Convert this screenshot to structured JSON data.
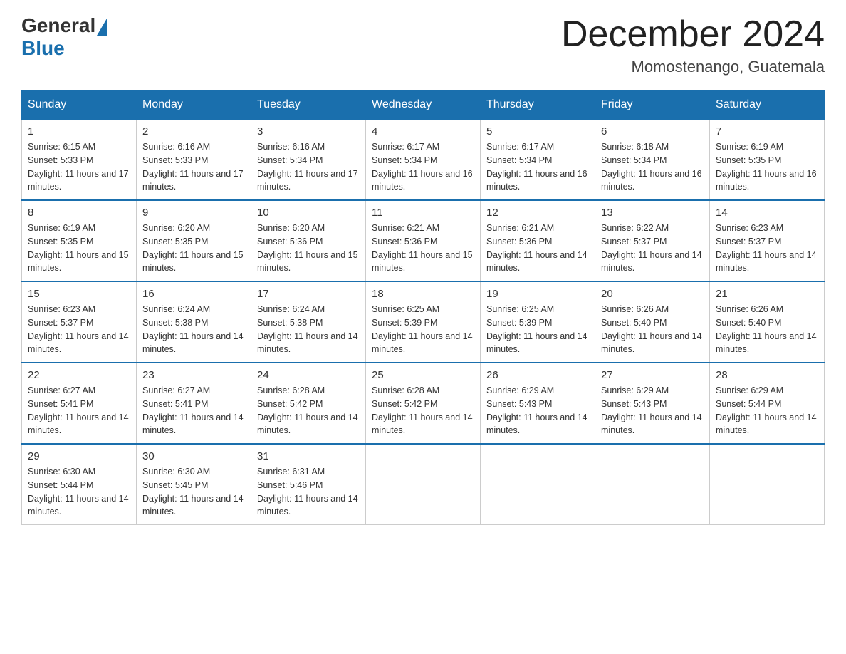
{
  "logo": {
    "general": "General",
    "blue": "Blue"
  },
  "title": "December 2024",
  "location": "Momostenango, Guatemala",
  "weekdays": [
    "Sunday",
    "Monday",
    "Tuesday",
    "Wednesday",
    "Thursday",
    "Friday",
    "Saturday"
  ],
  "weeks": [
    [
      {
        "day": "1",
        "sunrise": "6:15 AM",
        "sunset": "5:33 PM",
        "daylight": "11 hours and 17 minutes."
      },
      {
        "day": "2",
        "sunrise": "6:16 AM",
        "sunset": "5:33 PM",
        "daylight": "11 hours and 17 minutes."
      },
      {
        "day": "3",
        "sunrise": "6:16 AM",
        "sunset": "5:34 PM",
        "daylight": "11 hours and 17 minutes."
      },
      {
        "day": "4",
        "sunrise": "6:17 AM",
        "sunset": "5:34 PM",
        "daylight": "11 hours and 16 minutes."
      },
      {
        "day": "5",
        "sunrise": "6:17 AM",
        "sunset": "5:34 PM",
        "daylight": "11 hours and 16 minutes."
      },
      {
        "day": "6",
        "sunrise": "6:18 AM",
        "sunset": "5:34 PM",
        "daylight": "11 hours and 16 minutes."
      },
      {
        "day": "7",
        "sunrise": "6:19 AM",
        "sunset": "5:35 PM",
        "daylight": "11 hours and 16 minutes."
      }
    ],
    [
      {
        "day": "8",
        "sunrise": "6:19 AM",
        "sunset": "5:35 PM",
        "daylight": "11 hours and 15 minutes."
      },
      {
        "day": "9",
        "sunrise": "6:20 AM",
        "sunset": "5:35 PM",
        "daylight": "11 hours and 15 minutes."
      },
      {
        "day": "10",
        "sunrise": "6:20 AM",
        "sunset": "5:36 PM",
        "daylight": "11 hours and 15 minutes."
      },
      {
        "day": "11",
        "sunrise": "6:21 AM",
        "sunset": "5:36 PM",
        "daylight": "11 hours and 15 minutes."
      },
      {
        "day": "12",
        "sunrise": "6:21 AM",
        "sunset": "5:36 PM",
        "daylight": "11 hours and 14 minutes."
      },
      {
        "day": "13",
        "sunrise": "6:22 AM",
        "sunset": "5:37 PM",
        "daylight": "11 hours and 14 minutes."
      },
      {
        "day": "14",
        "sunrise": "6:23 AM",
        "sunset": "5:37 PM",
        "daylight": "11 hours and 14 minutes."
      }
    ],
    [
      {
        "day": "15",
        "sunrise": "6:23 AM",
        "sunset": "5:37 PM",
        "daylight": "11 hours and 14 minutes."
      },
      {
        "day": "16",
        "sunrise": "6:24 AM",
        "sunset": "5:38 PM",
        "daylight": "11 hours and 14 minutes."
      },
      {
        "day": "17",
        "sunrise": "6:24 AM",
        "sunset": "5:38 PM",
        "daylight": "11 hours and 14 minutes."
      },
      {
        "day": "18",
        "sunrise": "6:25 AM",
        "sunset": "5:39 PM",
        "daylight": "11 hours and 14 minutes."
      },
      {
        "day": "19",
        "sunrise": "6:25 AM",
        "sunset": "5:39 PM",
        "daylight": "11 hours and 14 minutes."
      },
      {
        "day": "20",
        "sunrise": "6:26 AM",
        "sunset": "5:40 PM",
        "daylight": "11 hours and 14 minutes."
      },
      {
        "day": "21",
        "sunrise": "6:26 AM",
        "sunset": "5:40 PM",
        "daylight": "11 hours and 14 minutes."
      }
    ],
    [
      {
        "day": "22",
        "sunrise": "6:27 AM",
        "sunset": "5:41 PM",
        "daylight": "11 hours and 14 minutes."
      },
      {
        "day": "23",
        "sunrise": "6:27 AM",
        "sunset": "5:41 PM",
        "daylight": "11 hours and 14 minutes."
      },
      {
        "day": "24",
        "sunrise": "6:28 AM",
        "sunset": "5:42 PM",
        "daylight": "11 hours and 14 minutes."
      },
      {
        "day": "25",
        "sunrise": "6:28 AM",
        "sunset": "5:42 PM",
        "daylight": "11 hours and 14 minutes."
      },
      {
        "day": "26",
        "sunrise": "6:29 AM",
        "sunset": "5:43 PM",
        "daylight": "11 hours and 14 minutes."
      },
      {
        "day": "27",
        "sunrise": "6:29 AM",
        "sunset": "5:43 PM",
        "daylight": "11 hours and 14 minutes."
      },
      {
        "day": "28",
        "sunrise": "6:29 AM",
        "sunset": "5:44 PM",
        "daylight": "11 hours and 14 minutes."
      }
    ],
    [
      {
        "day": "29",
        "sunrise": "6:30 AM",
        "sunset": "5:44 PM",
        "daylight": "11 hours and 14 minutes."
      },
      {
        "day": "30",
        "sunrise": "6:30 AM",
        "sunset": "5:45 PM",
        "daylight": "11 hours and 14 minutes."
      },
      {
        "day": "31",
        "sunrise": "6:31 AM",
        "sunset": "5:46 PM",
        "daylight": "11 hours and 14 minutes."
      },
      null,
      null,
      null,
      null
    ]
  ],
  "labels": {
    "sunrise": "Sunrise:",
    "sunset": "Sunset:",
    "daylight": "Daylight:"
  }
}
